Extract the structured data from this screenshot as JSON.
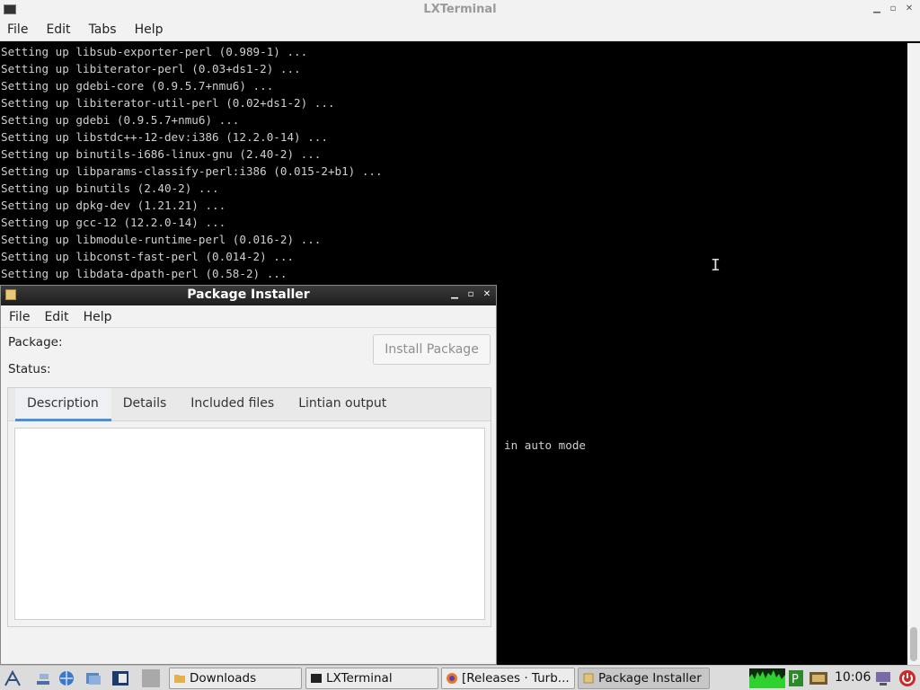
{
  "terminal": {
    "title": "LXTerminal",
    "menu": [
      "File",
      "Edit",
      "Tabs",
      "Help"
    ],
    "lines": [
      "Setting up libsub-exporter-perl (0.989-1) ...",
      "Setting up libiterator-perl (0.03+ds1-2) ...",
      "Setting up gdebi-core (0.9.5.7+nmu6) ...",
      "Setting up libiterator-util-perl (0.02+ds1-2) ...",
      "Setting up gdebi (0.9.5.7+nmu6) ...",
      "Setting up libstdc++-12-dev:i386 (12.2.0-14) ...",
      "Setting up binutils-i686-linux-gnu (2.40-2) ...",
      "Setting up libparams-classify-perl:i386 (0.015-2+b1) ...",
      "Setting up binutils (2.40-2) ...",
      "Setting up dpkg-dev (1.21.21) ...",
      "Setting up gcc-12 (12.2.0-14) ...",
      "Setting up libmodule-runtime-perl (0.016-2) ...",
      "Setting up libconst-fast-perl (0.014-2) ...",
      "Setting up libdata-dpath-perl (0.58-2) ..."
    ],
    "partial_line": "in auto mode"
  },
  "installer": {
    "title": "Package Installer",
    "menu": [
      "File",
      "Edit",
      "Help"
    ],
    "package_label": "Package:",
    "status_label": "Status:",
    "install_button": "Install Package",
    "tabs": [
      "Description",
      "Details",
      "Included files",
      "Lintian output"
    ],
    "active_tab": "Description"
  },
  "taskbar": {
    "tasks": [
      "Downloads",
      "LXTerminal",
      "[Releases · Turb...",
      "Package Installer"
    ],
    "active_task": "Package Installer",
    "clock": "10:06"
  },
  "colors": {
    "accent": "#4a90d9",
    "terminal_bg": "#000000",
    "terminal_fg": "#cfcfcf"
  }
}
